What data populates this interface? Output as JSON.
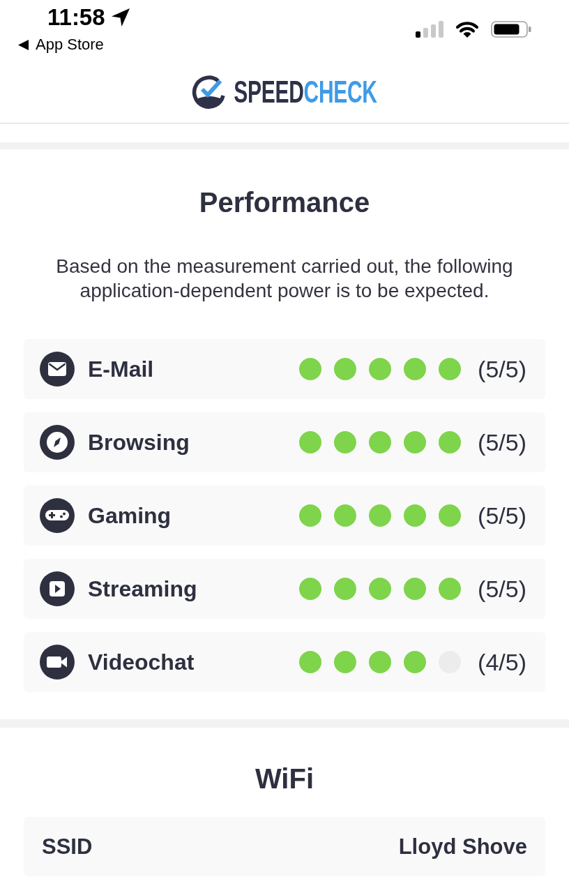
{
  "status_bar": {
    "time": "11:58",
    "back_label": "App Store"
  },
  "header": {
    "logo": {
      "parts": [
        {
          "text": "SPEED",
          "kind": "primary"
        },
        {
          "text": "CHECK",
          "kind": "accent"
        }
      ]
    }
  },
  "sections": [
    {
      "kind": "ratings",
      "title": "Performance",
      "description": "Based on the measurement carried out, the following application-dependent power is to be expected.",
      "items": [
        {
          "kind": "email",
          "label": "E-Mail",
          "stars": 5,
          "score": "(5/5)"
        },
        {
          "kind": "compass",
          "label": "Browsing",
          "stars": 5,
          "score": "(5/5)"
        },
        {
          "kind": "gamepad",
          "label": "Gaming",
          "stars": 5,
          "score": "(5/5)"
        },
        {
          "kind": "play",
          "label": "Streaming",
          "stars": 5,
          "score": "(5/5)"
        },
        {
          "kind": "camera",
          "label": "Videochat",
          "stars": 4,
          "score": "(4/5)"
        }
      ]
    },
    {
      "kind": "details",
      "title": "WiFi",
      "rows": [
        {
          "label": "SSID",
          "value": "Lloyd Shove"
        }
      ]
    }
  ]
}
